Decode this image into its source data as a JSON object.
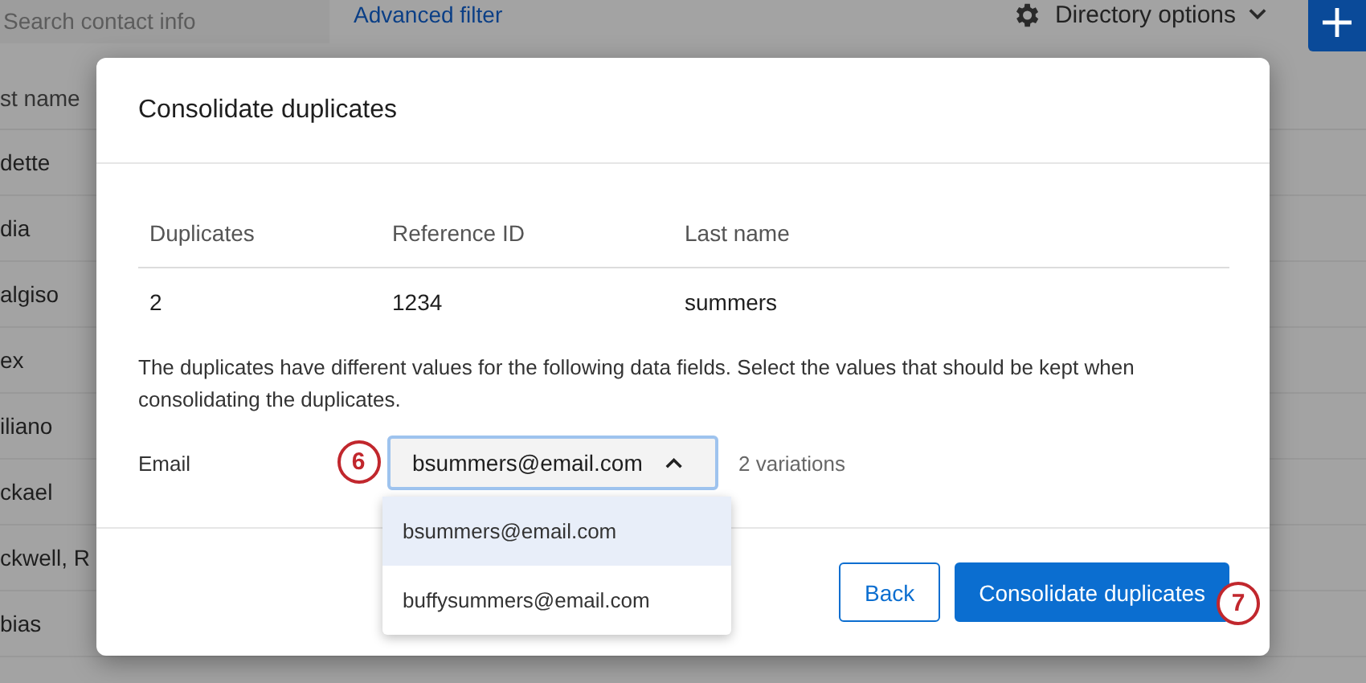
{
  "background": {
    "search": {
      "placeholder": "Search contact info"
    },
    "advanced_filter": "Advanced filter",
    "directory_options": "Directory options",
    "column_header": "st name",
    "rows": [
      "dette",
      "dia",
      "algiso",
      "ex",
      "iliano",
      "ckael",
      "ckwell, R",
      "bias"
    ]
  },
  "dialog": {
    "title": "Consolidate duplicates",
    "table": {
      "columns": [
        "Duplicates",
        "Reference ID",
        "Last name"
      ],
      "rows": [
        [
          "2",
          "1234",
          "summers"
        ]
      ]
    },
    "message": "The duplicates have different values for the following data fields. Select the values that should be kept when consolidating the duplicates.",
    "field": {
      "label": "Email",
      "value": "bsummers@email.com",
      "expanded": true,
      "variations": "2 variations",
      "options": [
        {
          "label": "bsummers@email.com",
          "selected": true
        },
        {
          "label": "buffysummers@email.com",
          "selected": false
        }
      ]
    },
    "buttons": [
      {
        "label": "Back",
        "kind": "secondary"
      },
      {
        "label": "Consolidate duplicates",
        "kind": "primary"
      }
    ]
  },
  "callouts": [
    {
      "label": "6"
    },
    {
      "label": "7"
    }
  ]
}
